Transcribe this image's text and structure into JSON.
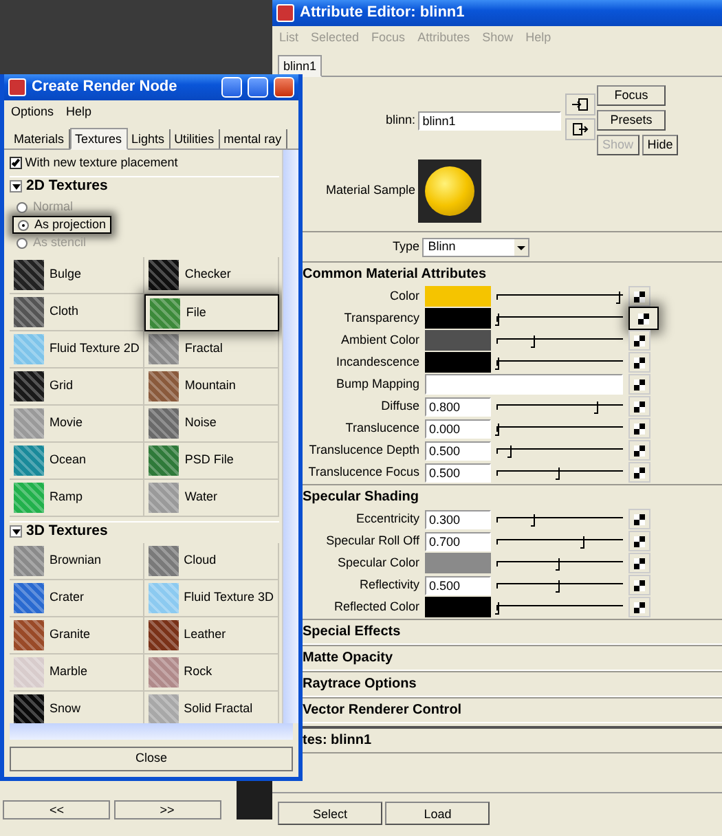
{
  "background_panel": {
    "buttons": [
      "<<",
      ">>"
    ]
  },
  "attribute_editor": {
    "title": "Attribute Editor: blinn1",
    "menu": [
      {
        "label": "List",
        "disabled": true
      },
      {
        "label": "Selected",
        "disabled": true
      },
      {
        "label": "Focus",
        "disabled": true
      },
      {
        "label": "Attributes",
        "disabled": true
      },
      {
        "label": "Show",
        "disabled": true
      },
      {
        "label": "Help",
        "disabled": true
      }
    ],
    "tabs": [
      {
        "label": "blinn1",
        "selected": true
      }
    ],
    "node_field": {
      "label": "blinn:",
      "value": "blinn1"
    },
    "side_buttons": [
      {
        "label": "Focus",
        "disabled": false
      },
      {
        "label": "Presets",
        "disabled": false
      },
      {
        "label": "Show",
        "disabled": true
      },
      {
        "label": "Hide",
        "disabled": false
      }
    ],
    "material_sample": {
      "label": "Material Sample"
    },
    "type_field": {
      "label": "Type",
      "value": "Blinn"
    },
    "sections": [
      {
        "title": "Common Material Attributes",
        "expanded": true,
        "rows": [
          {
            "label": "Color",
            "kind": "color",
            "color": "#f5c400",
            "level": 0.98,
            "map_highlighted": false
          },
          {
            "label": "Transparency",
            "kind": "color",
            "color": "#000000",
            "level": 0.02,
            "map_highlighted": true
          },
          {
            "label": "Ambient Color",
            "kind": "color",
            "color": "#505050",
            "level": 0.3,
            "map_highlighted": false
          },
          {
            "label": "Incandescence",
            "kind": "color",
            "color": "#000000",
            "level": 0.02,
            "map_highlighted": false
          },
          {
            "label": "Bump Mapping",
            "kind": "map",
            "map_highlighted": false
          },
          {
            "label": "Diffuse",
            "kind": "number",
            "value": "0.800",
            "level": 0.8,
            "map_highlighted": false
          },
          {
            "label": "Translucence",
            "kind": "number",
            "value": "0.000",
            "level": 0.02,
            "map_highlighted": false
          },
          {
            "label": "Translucence Depth",
            "kind": "number",
            "value": "0.500",
            "level": 0.12,
            "map_highlighted": false
          },
          {
            "label": "Translucence Focus",
            "kind": "number",
            "value": "0.500",
            "level": 0.5,
            "map_highlighted": false
          }
        ]
      },
      {
        "title": "Specular Shading",
        "expanded": true,
        "rows": [
          {
            "label": "Eccentricity",
            "kind": "number",
            "value": "0.300",
            "level": 0.3,
            "map_highlighted": false
          },
          {
            "label": "Specular Roll Off",
            "kind": "number",
            "value": "0.700",
            "level": 0.7,
            "map_highlighted": false
          },
          {
            "label": "Specular Color",
            "kind": "color",
            "color": "#8a8a8a",
            "level": 0.5,
            "map_highlighted": false
          },
          {
            "label": "Reflectivity",
            "kind": "number",
            "value": "0.500",
            "level": 0.5,
            "map_highlighted": false
          },
          {
            "label": "Reflected Color",
            "kind": "color",
            "color": "#000000",
            "level": 0.02,
            "map_highlighted": false
          }
        ]
      },
      {
        "title": "Special Effects",
        "expanded": false
      },
      {
        "title": "Matte Opacity",
        "expanded": false
      },
      {
        "title": "Raytrace Options",
        "expanded": false
      },
      {
        "title": "Vector Renderer Control",
        "expanded": false
      }
    ],
    "footer_label": "tes:  blinn1",
    "bottom_buttons": [
      "Select",
      "Load"
    ]
  },
  "render_node": {
    "title": "Create Render Node",
    "menu": [
      "Options",
      "Help"
    ],
    "tabs": [
      {
        "label": "Materials",
        "selected": false
      },
      {
        "label": "Textures",
        "selected": true
      },
      {
        "label": "Lights",
        "selected": false
      },
      {
        "label": "Utilities",
        "selected": false
      },
      {
        "label": "mental ray",
        "selected": false
      }
    ],
    "texture_placement": {
      "label": "With new texture placement",
      "checked": true
    },
    "sections": [
      {
        "title": "2D Textures",
        "expanded": true,
        "projection_options": [
          {
            "label": "Normal",
            "selected": false,
            "highlighted": false
          },
          {
            "label": "As projection",
            "selected": true,
            "highlighted": true
          },
          {
            "label": "As stencil",
            "selected": false,
            "highlighted": false
          }
        ],
        "items": [
          {
            "label": "Bulge",
            "color": "#222222",
            "highlighted": false
          },
          {
            "label": "Checker",
            "color": "#111111",
            "highlighted": false
          },
          {
            "label": "Cloth",
            "color": "#555555",
            "highlighted": false
          },
          {
            "label": "File",
            "color": "#3c8a3a",
            "highlighted": true
          },
          {
            "label": "Fluid Texture 2D",
            "color": "#7ec4ea",
            "highlighted": false
          },
          {
            "label": "Fractal",
            "color": "#8c8c8c",
            "highlighted": false
          },
          {
            "label": "Grid",
            "color": "#1a1a1a",
            "highlighted": false
          },
          {
            "label": "Mountain",
            "color": "#8a5a3c",
            "highlighted": false
          },
          {
            "label": "Movie",
            "color": "#9a9a9a",
            "highlighted": false
          },
          {
            "label": "Noise",
            "color": "#6a6a6a",
            "highlighted": false
          },
          {
            "label": "Ocean",
            "color": "#1a8a9a",
            "highlighted": false
          },
          {
            "label": "PSD File",
            "color": "#2f7a3a",
            "highlighted": false
          },
          {
            "label": "Ramp",
            "color": "#22b14c",
            "highlighted": false
          },
          {
            "label": "Water",
            "color": "#9a9a9a",
            "highlighted": false
          }
        ]
      },
      {
        "title": "3D Textures",
        "expanded": true,
        "items": [
          {
            "label": "Brownian",
            "color": "#8a8a8a",
            "highlighted": false
          },
          {
            "label": "Cloud",
            "color": "#7a7a7a",
            "highlighted": false
          },
          {
            "label": "Crater",
            "color": "#2a6ad0",
            "highlighted": false
          },
          {
            "label": "Fluid Texture 3D",
            "color": "#8ccaf0",
            "highlighted": false
          },
          {
            "label": "Granite",
            "color": "#9a4a28",
            "highlighted": false
          },
          {
            "label": "Leather",
            "color": "#7a3218",
            "highlighted": false
          },
          {
            "label": "Marble",
            "color": "#d8cccc",
            "highlighted": false
          },
          {
            "label": "Rock",
            "color": "#b08a8a",
            "highlighted": false
          },
          {
            "label": "Snow",
            "color": "#0a0a0a",
            "highlighted": false
          },
          {
            "label": "Solid Fractal",
            "color": "#a8a8a8",
            "highlighted": false
          }
        ]
      }
    ],
    "close_button": "Close"
  }
}
